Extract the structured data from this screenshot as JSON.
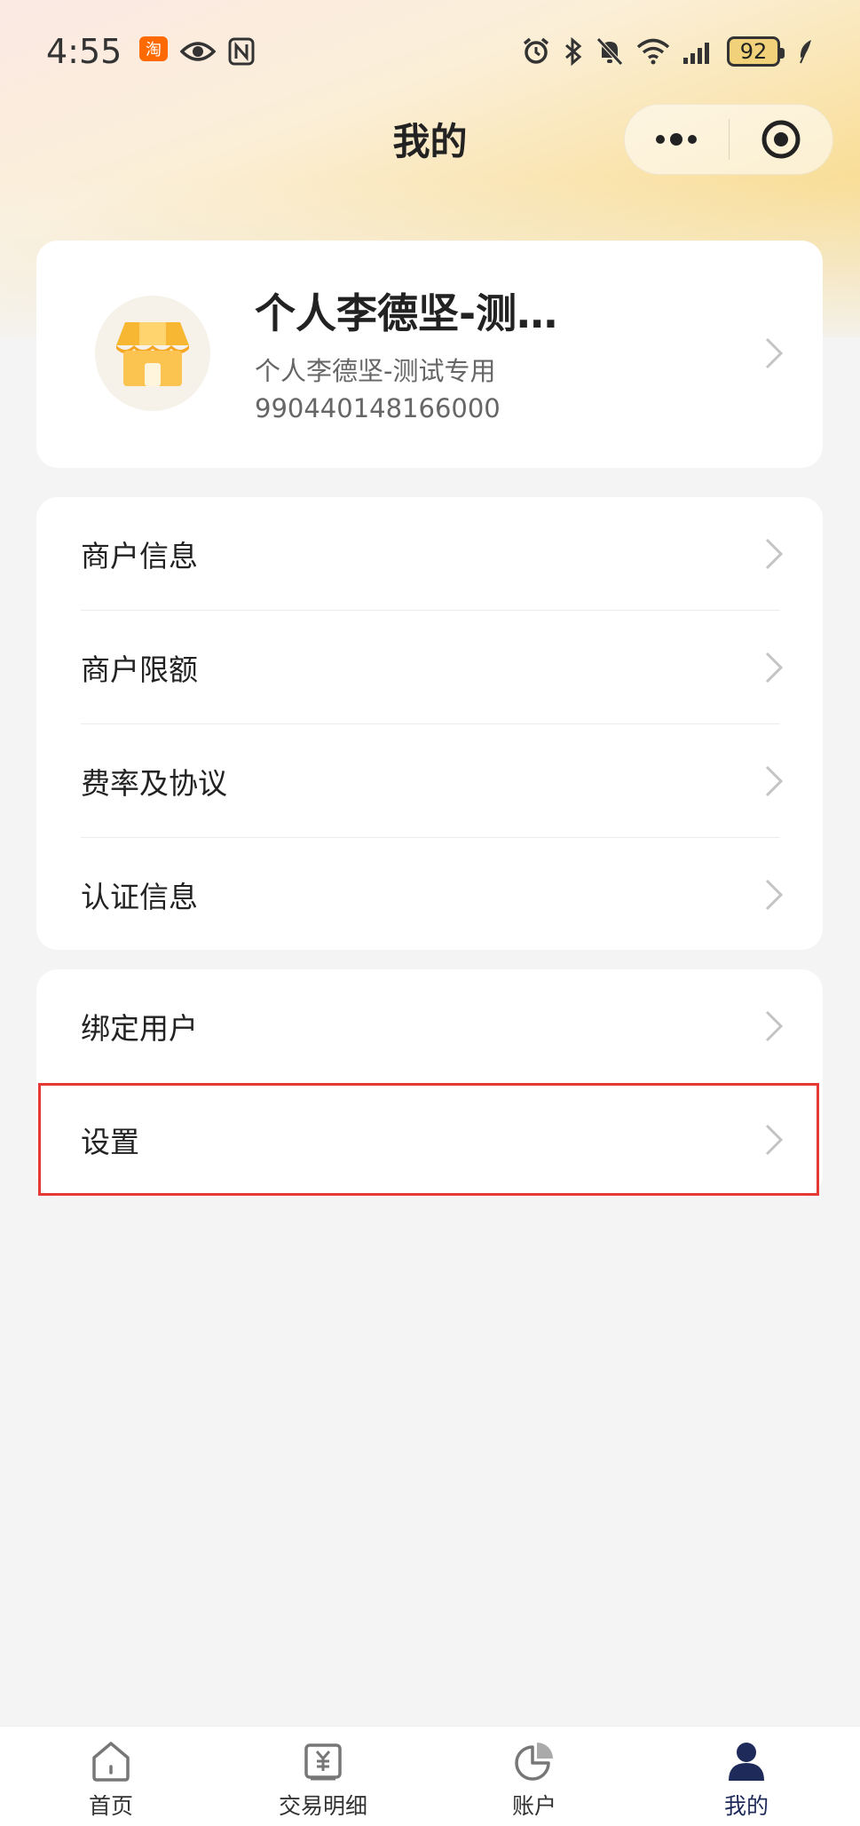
{
  "status_bar": {
    "time": "4:55",
    "battery": "92",
    "icons_left": [
      "taobao-icon",
      "eye-icon",
      "nfc-icon"
    ],
    "icons_right": [
      "alarm-icon",
      "bluetooth-icon",
      "mute-icon",
      "wifi-icon",
      "signal-icon",
      "battery-icon",
      "leaf-icon"
    ]
  },
  "nav": {
    "title": "我的",
    "capsule": [
      "more-icon",
      "close-target-icon"
    ]
  },
  "profile": {
    "name": "个人李德坚-测…",
    "subtitle": "个人李德坚-测试专用",
    "merchant_id": "990440148166000",
    "avatar_icon": "store-icon",
    "avatar_color": "#f7b733"
  },
  "menu_group_1": [
    {
      "label": "商户信息"
    },
    {
      "label": "商户限额"
    },
    {
      "label": "费率及协议"
    },
    {
      "label": "认证信息"
    }
  ],
  "menu_group_2": [
    {
      "label": "绑定用户"
    },
    {
      "label": "设置"
    }
  ],
  "tabs": [
    {
      "label": "首页",
      "icon": "home-icon",
      "active": false
    },
    {
      "label": "交易明细",
      "icon": "yen-receipt-icon",
      "active": false
    },
    {
      "label": "账户",
      "icon": "pie-chart-icon",
      "active": false
    },
    {
      "label": "我的",
      "icon": "user-icon",
      "active": true
    }
  ],
  "colors": {
    "accent": "#1e2a5a",
    "highlight": "#e53935",
    "header_gradient": "#f9de98"
  }
}
